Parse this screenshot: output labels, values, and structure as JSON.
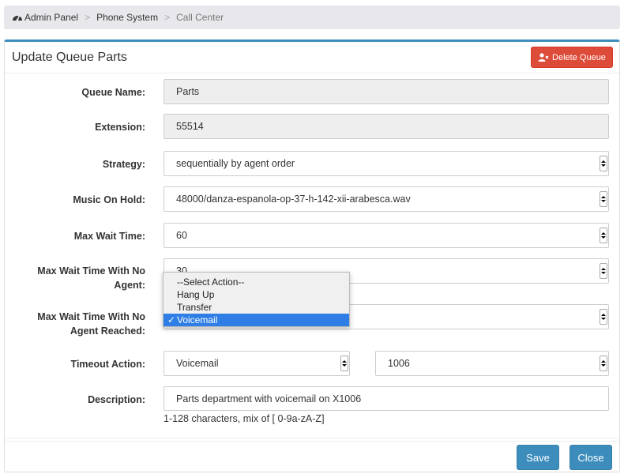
{
  "breadcrumb": {
    "items": [
      "Admin Panel",
      "Phone System"
    ],
    "current": "Call Center",
    "separator": ">"
  },
  "panel": {
    "title": "Update Queue Parts",
    "delete_label": "Delete Queue"
  },
  "form": {
    "queue_name": {
      "label": "Queue Name:",
      "value": "Parts"
    },
    "extension": {
      "label": "Extension:",
      "value": "55514"
    },
    "strategy": {
      "label": "Strategy:",
      "value": "sequentially by agent order"
    },
    "music_on_hold": {
      "label": "Music On Hold:",
      "value": "48000/danza-espanola-op-37-h-142-xii-arabesca.wav"
    },
    "max_wait_time": {
      "label": "Max Wait Time:",
      "value": "60"
    },
    "max_wait_no_agent": {
      "label_line1": "Max Wait Time With No",
      "label_line2": "Agent:",
      "value": "30"
    },
    "max_wait_no_agent_reached": {
      "label_line1": "Max Wait Time With No",
      "label_line2": "Agent Reached:",
      "value": ""
    },
    "timeout_action": {
      "label": "Timeout Action:",
      "options": [
        "--Select Action--",
        "Hang Up",
        "Transfer",
        "Voicemail"
      ],
      "selected": "Voicemail",
      "target_value": "1006"
    },
    "description": {
      "label": "Description:",
      "value": "Parts department with voicemail on X1006",
      "hint": "1-128 characters, mix of [ 0-9a-zA-Z]"
    }
  },
  "buttons": {
    "save": "Save",
    "close": "Close"
  },
  "colors": {
    "primary": "#3c8dbc",
    "danger": "#dd4b39",
    "dropdown_selected": "#2e7ee5",
    "readonly_bg": "#eeeeee",
    "breadcrumb_bg": "#e8e8ec"
  }
}
